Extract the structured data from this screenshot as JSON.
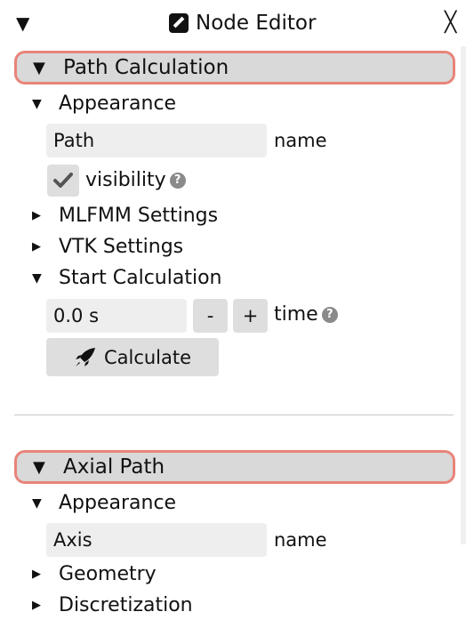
{
  "titlebar": {
    "collapse_glyph": "▼",
    "title": "Node Editor",
    "close_glyph": "╳",
    "edit_icon": "edit-icon"
  },
  "sections": [
    {
      "header": "Path Calculation",
      "appearance": {
        "label": "Appearance",
        "name_value": "Path",
        "name_label": "name",
        "visibility_label": "visibility",
        "visibility_checked": true
      },
      "mlfmm_label": "MLFMM Settings",
      "vtk_label": "VTK Settings",
      "start_calc": {
        "label": "Start Calculation",
        "time_value": "0.0 s",
        "minus_label": "-",
        "plus_label": "+",
        "time_label": "time",
        "calculate_label": "Calculate"
      }
    },
    {
      "header": "Axial Path",
      "appearance": {
        "label": "Appearance",
        "name_value": "Axis",
        "name_label": "name"
      },
      "geometry_label": "Geometry",
      "discretization_label": "Discretization"
    }
  ],
  "glyphs": {
    "down": "▼",
    "right": "▶",
    "help": "?"
  },
  "colors": {
    "highlight_border": "#e8847a",
    "header_bg": "#d9d9d9",
    "field_bg": "#eeeeee"
  }
}
